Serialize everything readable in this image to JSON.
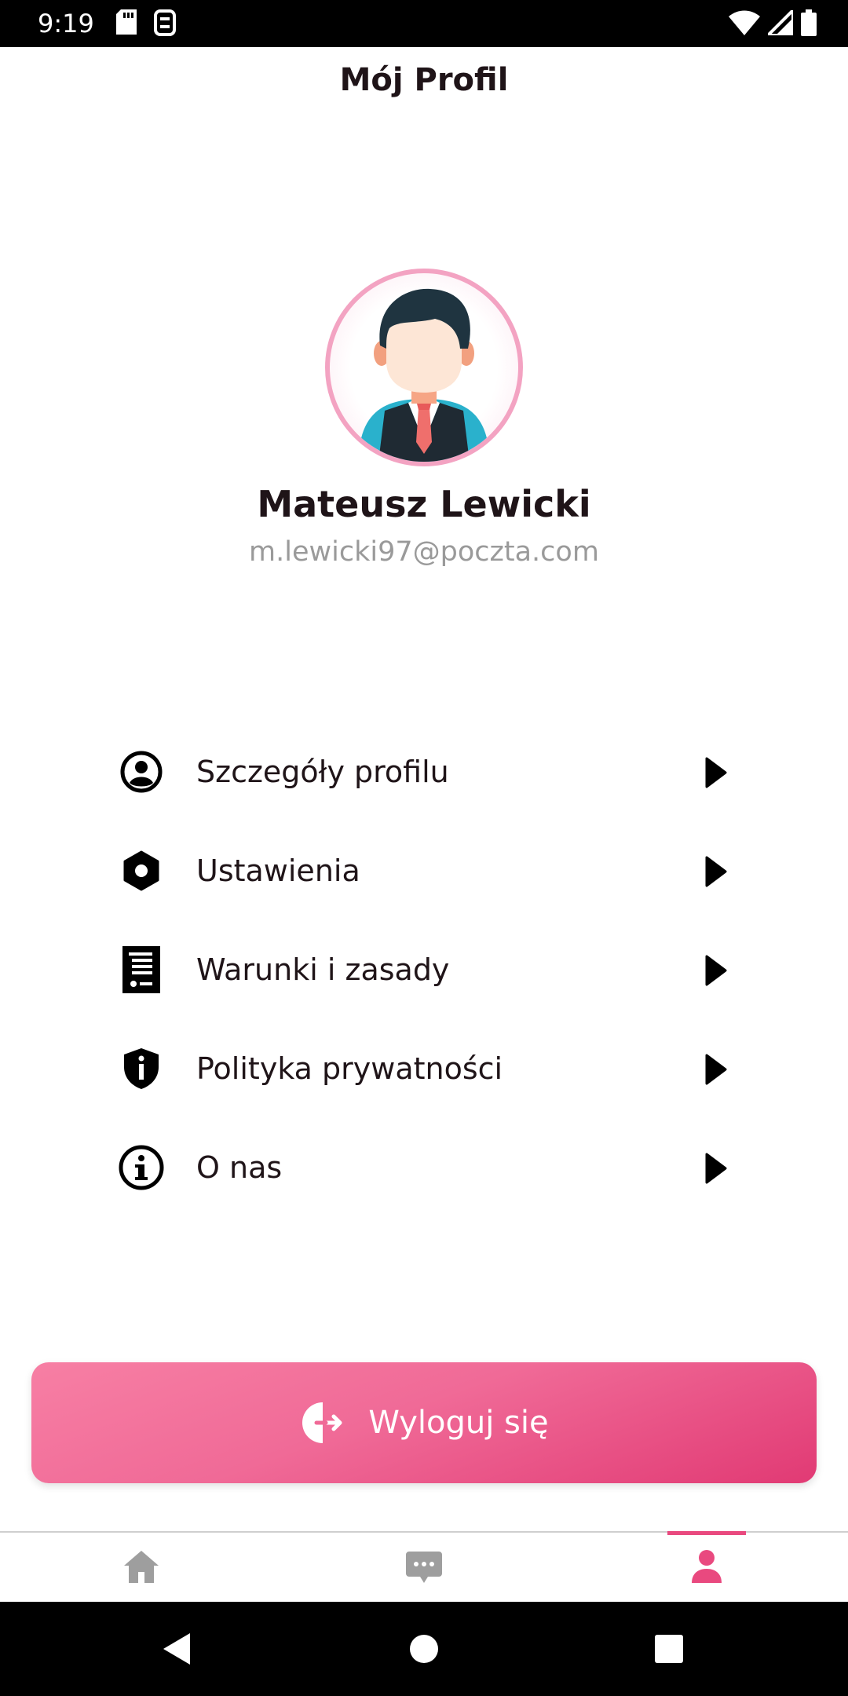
{
  "status_bar": {
    "time": "9:19",
    "icons": [
      "sd-card-icon",
      "nfc-icon",
      "wifi-icon",
      "signal-icon",
      "battery-icon"
    ]
  },
  "header": {
    "title": "Mój Profil"
  },
  "profile": {
    "avatar": "avatar-illustration",
    "name": "Mateusz Lewicki",
    "email": "m.lewicki97@poczta.com"
  },
  "menu": {
    "items": [
      {
        "label": "Szczegóły profilu",
        "icon": "user-circle-icon"
      },
      {
        "label": "Ustawienia",
        "icon": "settings-hex-icon"
      },
      {
        "label": "Warunki i zasady",
        "icon": "document-icon"
      },
      {
        "label": "Polityka prywatności",
        "icon": "shield-info-icon"
      },
      {
        "label": "O nas",
        "icon": "info-circle-icon"
      }
    ],
    "arrow_icon": "chevron-right-icon"
  },
  "logout": {
    "label": "Wyloguj się",
    "icon": "logout-icon"
  },
  "bottom_nav": {
    "tabs": [
      {
        "name": "home",
        "icon": "home-icon",
        "active": false
      },
      {
        "name": "chat",
        "icon": "chat-icon",
        "active": false
      },
      {
        "name": "profile",
        "icon": "user-icon",
        "active": true
      }
    ]
  },
  "colors": {
    "accent": "#e9497f",
    "button_gradient_start": "#f77fa4",
    "button_gradient_end": "#e13a74",
    "inactive_icon": "#9e9e9e",
    "text": "#1f1418",
    "muted_text": "#9a9a9a"
  }
}
